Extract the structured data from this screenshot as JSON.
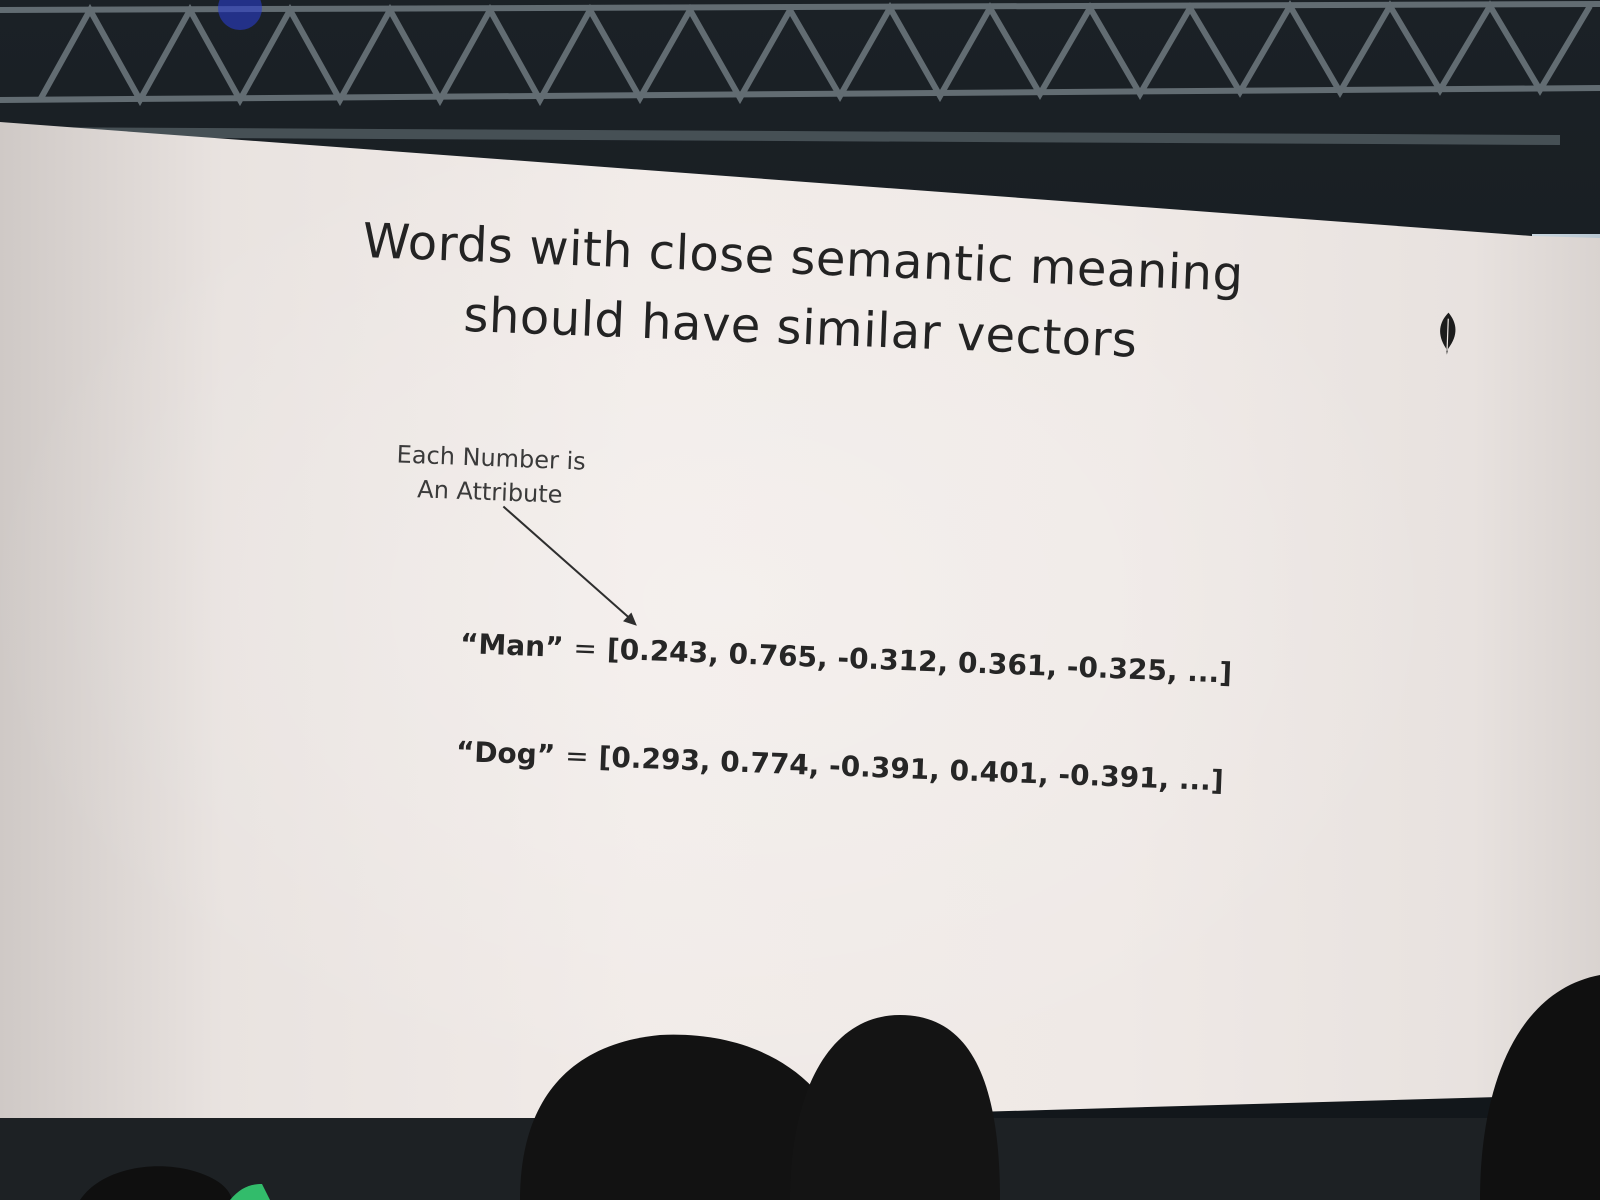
{
  "slide": {
    "title_lines": [
      "Words with close semantic meaning",
      "should have similar vectors"
    ],
    "annotation_lines": [
      "Each Number is",
      "An Attribute"
    ],
    "vectors": [
      {
        "word": "“Man”",
        "equals": "=",
        "values": "[0.243, 0.765, -0.312, 0.361, -0.325, ...]"
      },
      {
        "word": "“Dog”",
        "equals": "=",
        "values": "[0.293, 0.774, -0.391, 0.401, -0.391, ...]"
      }
    ],
    "logo_icon": "leaf-icon"
  },
  "colors": {
    "slide_background": "#efe9e6",
    "text": "#232323",
    "logo": "#1c1c1c",
    "venue_dark": "#15191c"
  }
}
